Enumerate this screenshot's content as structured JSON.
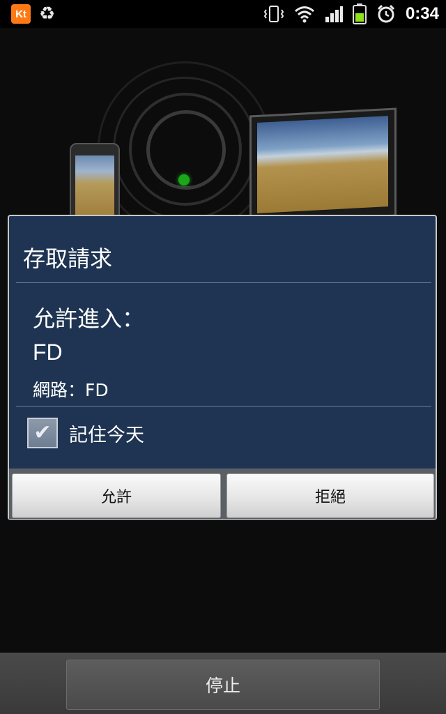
{
  "status_bar": {
    "carrier_badge": "Kt",
    "recycle_icon": "recycle-icon",
    "icons": [
      "vibrate-icon",
      "wifi-icon",
      "signal-icon",
      "battery-icon",
      "alarm-icon"
    ],
    "battery_color": "#8ee21a",
    "time": "0:34"
  },
  "dialog": {
    "title": "存取請求",
    "allow_access_label": "允許進入：",
    "device_name": "FD",
    "network_label": "網路：FD",
    "remember_label": "記住今天",
    "remember_checked": true,
    "allow_button": "允許",
    "deny_button": "拒絕"
  },
  "bottom": {
    "stop_button": "停止"
  },
  "colors": {
    "dialog_bg": "#1e3452",
    "indicator_green": "#1aa81a"
  }
}
